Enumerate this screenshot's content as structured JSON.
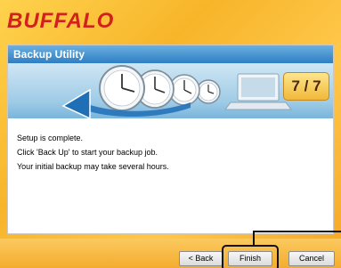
{
  "brand": {
    "logo_text": "BUFFALO"
  },
  "window": {
    "title": "Backup Utility"
  },
  "banner": {
    "step": "7 / 7"
  },
  "content": {
    "lines": [
      "Setup is complete.",
      "Click 'Back Up' to start your backup job.",
      "Your initial backup may take several hours."
    ]
  },
  "buttons": {
    "back": "< Back",
    "finish": "Finish",
    "cancel": "Cancel"
  },
  "colors": {
    "brand_red": "#d2201d",
    "title_blue": "#2f7ec3",
    "background_orange": "#f7b52a"
  },
  "icons": [
    "clock-icon",
    "computer-icon",
    "arrow-icon"
  ]
}
